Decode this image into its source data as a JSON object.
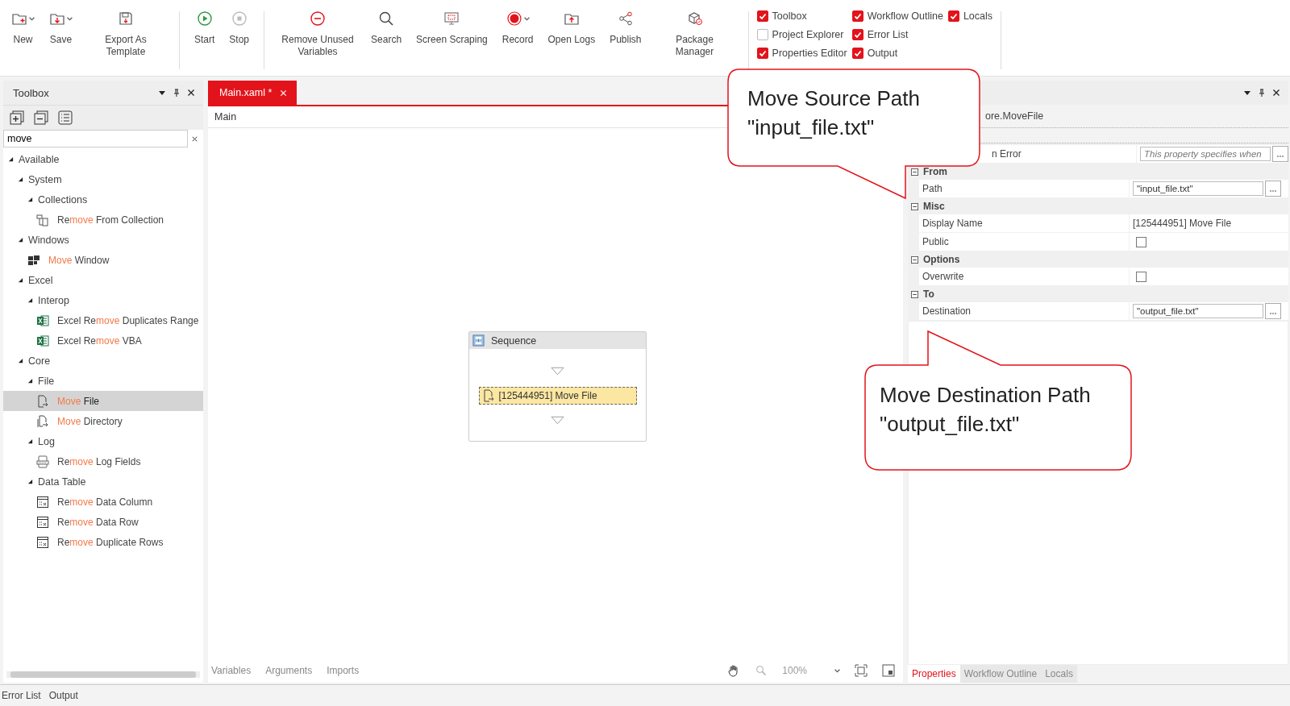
{
  "ribbon": {
    "groups": [
      {
        "items": [
          {
            "label": "New",
            "kind": "new",
            "dropdown": true
          },
          {
            "label": "Save",
            "kind": "save",
            "dropdown": true
          },
          {
            "label": "Export As Template",
            "kind": "export",
            "dropdown": false
          }
        ]
      },
      {
        "items": [
          {
            "label": "Start",
            "kind": "start",
            "dropdown": false
          },
          {
            "label": "Stop",
            "kind": "stop",
            "dropdown": false
          }
        ]
      },
      {
        "items": [
          {
            "label": "Remove Unused Variables",
            "kind": "remove",
            "dropdown": false
          },
          {
            "label": "Search",
            "kind": "search",
            "dropdown": false
          },
          {
            "label": "Screen Scraping",
            "kind": "scraping",
            "dropdown": false
          },
          {
            "label": "Record",
            "kind": "record",
            "dropdown": true
          },
          {
            "label": "Open Logs",
            "kind": "logs",
            "dropdown": false
          },
          {
            "label": "Publish",
            "kind": "publish",
            "dropdown": false
          },
          {
            "label": "Package Manager",
            "kind": "package",
            "dropdown": false
          }
        ]
      }
    ],
    "panel_toggles": [
      {
        "label": "Toolbox",
        "checked": true
      },
      {
        "label": "Project Explorer",
        "checked": false
      },
      {
        "label": "Properties Editor",
        "checked": true
      },
      {
        "label": "Workflow Outline",
        "checked": true
      },
      {
        "label": "Error List",
        "checked": true
      },
      {
        "label": "Output",
        "checked": true
      },
      {
        "label": "Locals",
        "checked": true
      }
    ]
  },
  "toolbox": {
    "title": "Toolbox",
    "search": {
      "value": "move"
    },
    "tree": [
      {
        "kind": "group",
        "label": "Available",
        "expanded": true,
        "children": [
          {
            "kind": "group",
            "label": "System",
            "expanded": true,
            "children": [
              {
                "kind": "group",
                "label": "Collections",
                "expanded": true,
                "children": [
                  {
                    "kind": "collection",
                    "selected": false,
                    "parts": [
                      {
                        "text": "Re",
                        "match": false
                      },
                      {
                        "text": "move",
                        "match": true
                      },
                      {
                        "text": " From Collection",
                        "match": false
                      }
                    ]
                  }
                ]
              }
            ]
          },
          {
            "kind": "group",
            "label": "Windows",
            "expanded": true,
            "children": [
              {
                "kind": "window",
                "selected": false,
                "parts": [
                  {
                    "text": "Move",
                    "match": true
                  },
                  {
                    "text": " Window",
                    "match": false
                  }
                ]
              }
            ]
          },
          {
            "kind": "group",
            "label": "Excel",
            "expanded": true,
            "children": [
              {
                "kind": "group",
                "label": "Interop",
                "expanded": true,
                "children": [
                  {
                    "kind": "excel",
                    "selected": false,
                    "parts": [
                      {
                        "text": "Excel Re",
                        "match": false
                      },
                      {
                        "text": "move",
                        "match": true
                      },
                      {
                        "text": " Duplicates Range",
                        "match": false
                      }
                    ]
                  },
                  {
                    "kind": "excel",
                    "selected": false,
                    "parts": [
                      {
                        "text": "Excel Re",
                        "match": false
                      },
                      {
                        "text": "move",
                        "match": true
                      },
                      {
                        "text": " VBA",
                        "match": false
                      }
                    ]
                  }
                ]
              }
            ]
          },
          {
            "kind": "group",
            "label": "Core",
            "expanded": true,
            "children": [
              {
                "kind": "group",
                "label": "File",
                "expanded": true,
                "children": [
                  {
                    "kind": "file",
                    "selected": true,
                    "parts": [
                      {
                        "text": "Move",
                        "match": true
                      },
                      {
                        "text": " File",
                        "match": false
                      }
                    ]
                  },
                  {
                    "kind": "directory",
                    "selected": false,
                    "parts": [
                      {
                        "text": "Move",
                        "match": true
                      },
                      {
                        "text": " Directory",
                        "match": false
                      }
                    ]
                  }
                ]
              },
              {
                "kind": "group",
                "label": "Log",
                "expanded": true,
                "children": [
                  {
                    "kind": "log",
                    "selected": false,
                    "parts": [
                      {
                        "text": "Re",
                        "match": false
                      },
                      {
                        "text": "move",
                        "match": true
                      },
                      {
                        "text": " Log Fields",
                        "match": false
                      }
                    ]
                  }
                ]
              },
              {
                "kind": "group",
                "label": "Data Table",
                "expanded": true,
                "children": [
                  {
                    "kind": "column",
                    "selected": false,
                    "parts": [
                      {
                        "text": "Re",
                        "match": false
                      },
                      {
                        "text": "move",
                        "match": true
                      },
                      {
                        "text": " Data Column",
                        "match": false
                      }
                    ]
                  },
                  {
                    "kind": "row",
                    "selected": false,
                    "parts": [
                      {
                        "text": "Re",
                        "match": false
                      },
                      {
                        "text": "move",
                        "match": true
                      },
                      {
                        "text": " Data Row",
                        "match": false
                      }
                    ]
                  },
                  {
                    "kind": "rows",
                    "selected": false,
                    "parts": [
                      {
                        "text": "Re",
                        "match": false
                      },
                      {
                        "text": "move",
                        "match": true
                      },
                      {
                        "text": " Duplicate Rows",
                        "match": false
                      }
                    ]
                  }
                ]
              }
            ]
          }
        ]
      }
    ]
  },
  "designer": {
    "tabs": [
      {
        "label": "Main.xaml *",
        "selected": true
      }
    ],
    "breadcrumb": "Main",
    "sequence": {
      "title": "Sequence",
      "activities": [
        {
          "label": "[125444951] Move File",
          "selected": true
        }
      ]
    },
    "bottom_tabs": [
      {
        "label": "Variables"
      },
      {
        "label": "Arguments"
      },
      {
        "label": "Imports"
      }
    ],
    "zoom": "100%"
  },
  "properties": {
    "type_name": "ore.MoveFile",
    "rows": [
      {
        "kind": "field",
        "name": "n Error",
        "placeholder": "This property specifies when"
      },
      {
        "kind": "category",
        "name": "From",
        "expanded": true
      },
      {
        "kind": "field",
        "name": "Path",
        "value": "\"input_file.txt\""
      },
      {
        "kind": "category",
        "name": "Misc",
        "expanded": true
      },
      {
        "kind": "text",
        "name": "Display Name",
        "value": "[125444951] Move File"
      },
      {
        "kind": "checkbox",
        "name": "Public",
        "checked": false
      },
      {
        "kind": "category",
        "name": "Options",
        "expanded": true
      },
      {
        "kind": "checkbox",
        "name": "Overwrite",
        "checked": false
      },
      {
        "kind": "category",
        "name": "To",
        "expanded": true
      },
      {
        "kind": "field",
        "name": "Destination",
        "value": "\"output_file.txt\""
      }
    ],
    "tabs": [
      {
        "label": "Properties",
        "selected": true
      },
      {
        "label": "Workflow Outline",
        "selected": false
      },
      {
        "label": "Locals",
        "selected": false
      }
    ]
  },
  "callouts": [
    {
      "text": "Move Source Path\n\"input_file.txt\""
    },
    {
      "text": "Move Destination Path\n\"output_file.txt\""
    }
  ],
  "status_bar": {
    "tabs": [
      {
        "label": "Error List"
      },
      {
        "label": "Output"
      }
    ]
  }
}
